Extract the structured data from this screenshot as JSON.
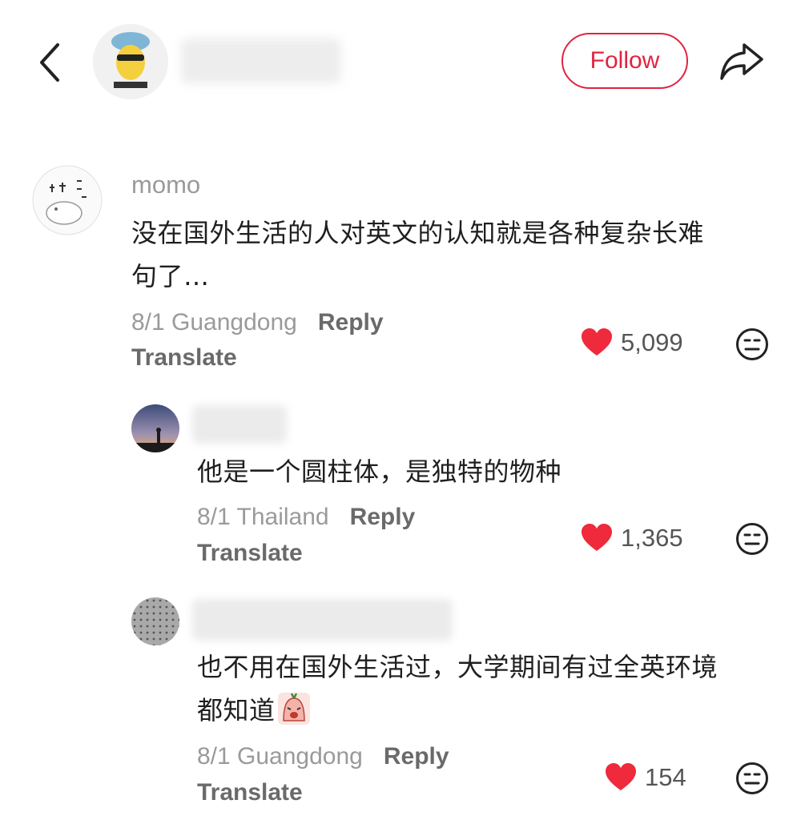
{
  "header": {
    "back_icon": "chevron-left-icon",
    "follow_label": "Follow",
    "share_icon": "share-arrow-icon"
  },
  "comments": [
    {
      "username": "momo",
      "text_line1": "没在国外生活的人对英文的认知就是各种复杂长难",
      "text_line2": "句了…",
      "date_location": "8/1 Guangdong",
      "reply_label": "Reply",
      "translate_label": "Translate",
      "likes": "5,099"
    },
    {
      "username": "",
      "text_line1": "他是一个圆柱体，是独特的物种",
      "date_location": "8/1 Thailand",
      "reply_label": "Reply",
      "translate_label": "Translate",
      "likes": "1,365"
    },
    {
      "username": "",
      "text_line1": "也不用在国外生活过，大学期间有过全英环境",
      "text_line2": "都知道",
      "date_location": "8/1 Guangdong",
      "reply_label": "Reply",
      "translate_label": "Translate",
      "likes": "154"
    }
  ],
  "colors": {
    "accent": "#e0243f",
    "heart": "#ee2a3c",
    "meta_gray": "#9a9a9a"
  }
}
